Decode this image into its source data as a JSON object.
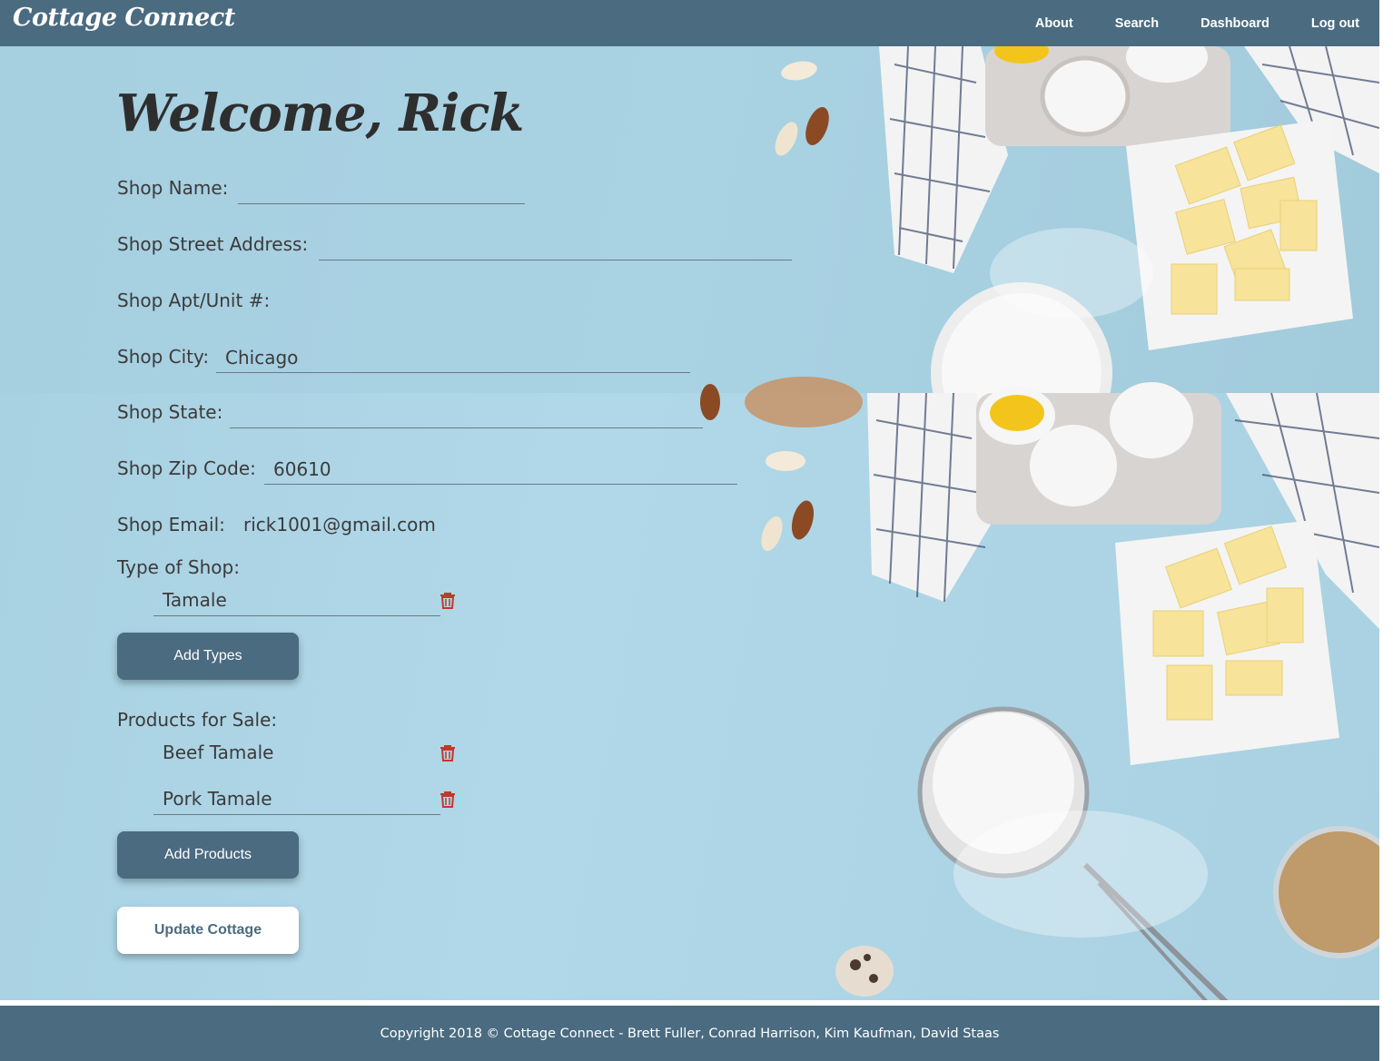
{
  "navbar": {
    "brand": "Cottage Connect",
    "links": [
      "About",
      "Search",
      "Dashboard",
      "Log out"
    ]
  },
  "welcome": "Welcome, Rick",
  "form": {
    "shop_name": {
      "label": "Shop Name:",
      "value": ""
    },
    "street": {
      "label": "Shop Street Address:",
      "value": ""
    },
    "unit": {
      "label": "Shop Apt/Unit #:"
    },
    "city": {
      "label": "Shop City:",
      "value": "Chicago"
    },
    "state": {
      "label": "Shop State:",
      "value": ""
    },
    "zip": {
      "label": "Shop Zip Code:",
      "value": "60610"
    },
    "email": {
      "label": "Shop Email:",
      "value": "rick1001@gmail.com"
    }
  },
  "types": {
    "label": "Type of Shop:",
    "items": [
      "Tamale"
    ],
    "add_button": "Add Types"
  },
  "products": {
    "label": "Products for Sale:",
    "items": [
      "Beef Tamale",
      "Pork Tamale"
    ],
    "add_button": "Add Products"
  },
  "update_button": "Update Cottage",
  "footer": "Copyright 2018 © Cottage Connect - Brett Fuller, Conrad Harrison, Kim Kaufman, David Staas",
  "colors": {
    "nav": "#4a6b80",
    "background": "#a9d2e3",
    "trash": "#c0392b"
  },
  "icons": {
    "delete": "trash-icon"
  }
}
